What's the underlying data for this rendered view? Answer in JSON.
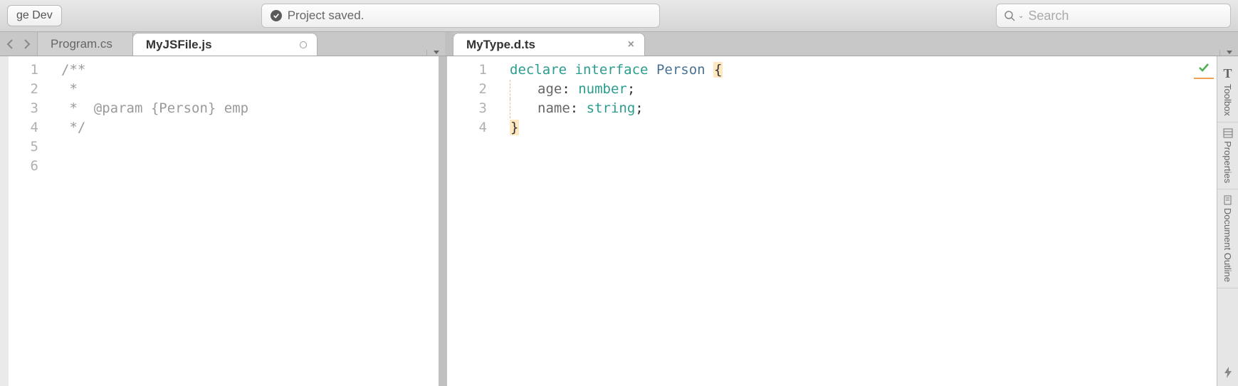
{
  "toolbar": {
    "config_button": "ge Dev",
    "status_text": "Project saved.",
    "search_placeholder": "Search"
  },
  "left_pane": {
    "tabs": [
      {
        "label": "Program.cs",
        "active": false
      },
      {
        "label": "MyJSFile.js",
        "active": true,
        "dirty": true
      }
    ],
    "gutter": [
      "1",
      "2",
      "3",
      "4",
      "5",
      "6"
    ],
    "code": {
      "l1": "/**",
      "l2": " *",
      "l3_a": " *  ",
      "l3_tag": "@param",
      "l3_b": " {Person} emp",
      "l4": " */"
    }
  },
  "right_pane": {
    "tabs": [
      {
        "label": "MyType.d.ts",
        "active": true
      }
    ],
    "gutter": [
      "1",
      "2",
      "3",
      "4"
    ],
    "code": {
      "l1_kw1": "declare",
      "l1_kw2": "interface",
      "l1_name": "Person",
      "l1_brace": "{",
      "l2_prop": "age",
      "l2_colon": ": ",
      "l2_type": "number",
      "l2_semi": ";",
      "l3_prop": "name",
      "l3_colon": ": ",
      "l3_type": "string",
      "l3_semi": ";",
      "l4_brace": "}"
    }
  },
  "sidebar": {
    "tools": [
      {
        "label": "Toolbox",
        "icon": "T"
      },
      {
        "label": "Properties",
        "icon": "props"
      },
      {
        "label": "Document Outline",
        "icon": "doc"
      }
    ]
  }
}
